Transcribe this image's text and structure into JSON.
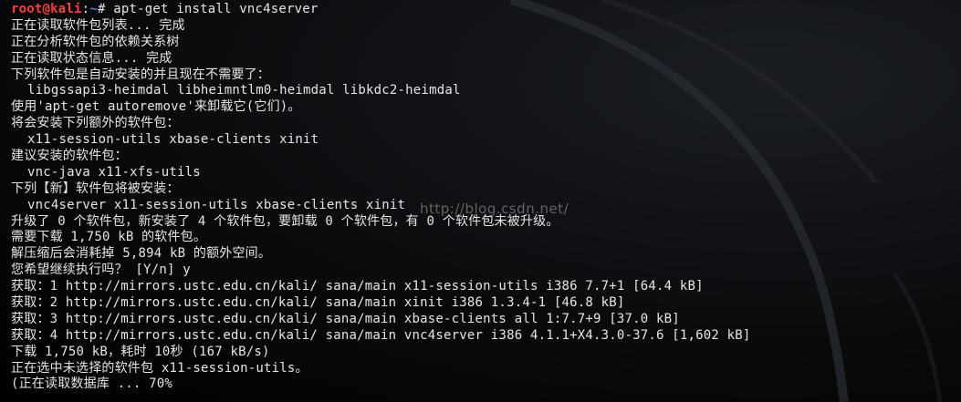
{
  "terminal": {
    "prompt": {
      "user_host": "root@kali",
      "separator": ":",
      "path": "~",
      "symbol": "# ",
      "command": "apt-get install vnc4server"
    },
    "lines": [
      "正在读取软件包列表... 完成",
      "正在分析软件包的依赖关系树",
      "正在读取状态信息... 完成",
      "下列软件包是自动安装的并且现在不需要了：",
      "libgssapi3-heimdal libheimntlm0-heimdal libkdc2-heimdal",
      "使用'apt-get autoremove'来卸载它(它们)。",
      "将会安装下列额外的软件包：",
      "x11-session-utils xbase-clients xinit",
      "建议安装的软件包：",
      "vnc-java x11-xfs-utils",
      "下列【新】软件包将被安装：",
      "vnc4server x11-session-utils xbase-clients xinit",
      "升级了 0 个软件包，新安装了 4 个软件包，要卸载 0 个软件包，有 0 个软件包未被升级。",
      "需要下载 1,750 kB 的软件包。",
      "解压缩后会消耗掉 5,894 kB 的额外空间。",
      "您希望继续执行吗？ [Y/n] y",
      "获取：1 http://mirrors.ustc.edu.cn/kali/ sana/main x11-session-utils i386 7.7+1 [64.4 kB]",
      "获取：2 http://mirrors.ustc.edu.cn/kali/ sana/main xinit i386 1.3.4-1 [46.8 kB]",
      "获取：3 http://mirrors.ustc.edu.cn/kali/ sana/main xbase-clients all 1:7.7+9 [37.0 kB]",
      "获取：4 http://mirrors.ustc.edu.cn/kali/ sana/main vnc4server i386 4.1.1+X4.3.0-37.6 [1,602 kB]",
      "下载 1,750 kB，耗时 10秒 (167 kB/s)",
      "正在选中未选择的软件包 x11-session-utils。",
      "(正在读取数据库 ... 70%"
    ],
    "watermark": "http://blog.csdn.net/"
  },
  "colors": {
    "background": "#000000",
    "text": "#e6e6e6",
    "user": "#ff3b3b",
    "path": "#4f7cff"
  }
}
